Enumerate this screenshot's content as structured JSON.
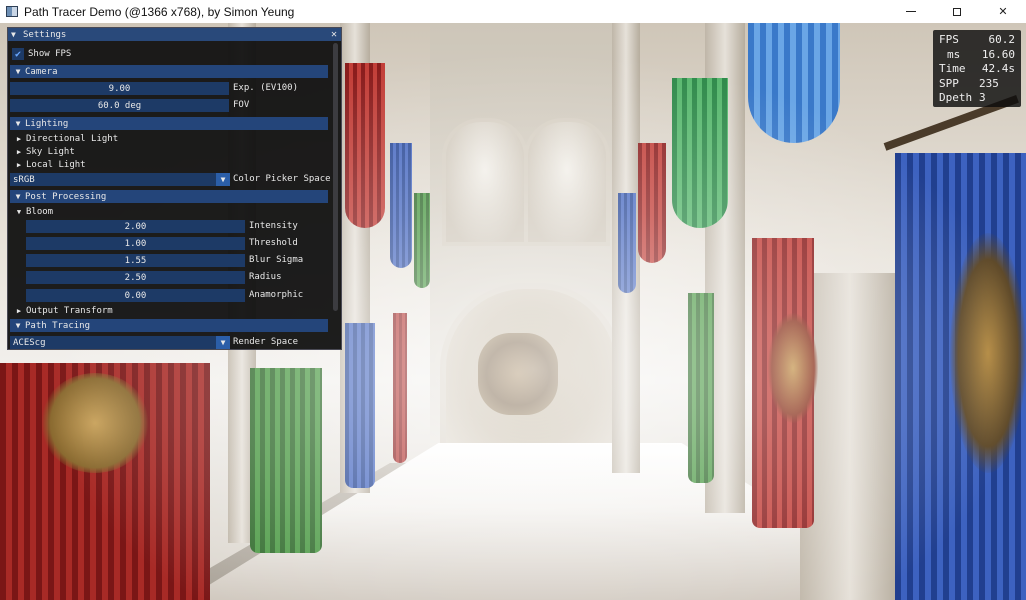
{
  "window": {
    "title": "Path Tracer Demo (@1366 x768), by Simon Yeung",
    "minimize_glyph": "—",
    "close_glyph": "✕"
  },
  "stats": {
    "fps_label": "FPS",
    "fps_value": "60.2",
    "ms_label": "ms",
    "ms_value": "16.60",
    "time_label": "Time",
    "time_value": "42.4s",
    "spp_label": "SPP",
    "spp_value": "235",
    "depth_label": "Dpeth",
    "depth_value": "3"
  },
  "settings": {
    "title": "Settings",
    "close_glyph": "✕",
    "show_fps_label": "Show FPS",
    "show_fps_checked": true,
    "camera": {
      "header": "Camera",
      "exposure_value": "9.00",
      "exposure_label": "Exp. (EV100)",
      "fov_value": "60.0 deg",
      "fov_label": "FOV"
    },
    "lighting": {
      "header": "Lighting",
      "items": [
        "Directional Light",
        "Sky Light",
        "Local Light"
      ]
    },
    "color_picker": {
      "value": "sRGB",
      "label": "Color Picker Space"
    },
    "post": {
      "header": "Post Processing",
      "bloom": {
        "header": "Bloom",
        "intensity_value": "2.00",
        "intensity_label": "Intensity",
        "threshold_value": "1.00",
        "threshold_label": "Threshold",
        "blur_value": "1.55",
        "blur_label": "Blur Sigma",
        "radius_value": "2.50",
        "radius_label": "Radius",
        "anamorphic_value": "0.00",
        "anamorphic_label": "Anamorphic"
      },
      "output_transform": "Output Transform"
    },
    "path_tracing": {
      "header": "Path Tracing",
      "render_space_value": "ACEScg",
      "render_space_label": "Render Space"
    }
  },
  "glyphs": {
    "open": "▼",
    "closed": "▶",
    "check": "✔",
    "dropdown": "▼"
  }
}
